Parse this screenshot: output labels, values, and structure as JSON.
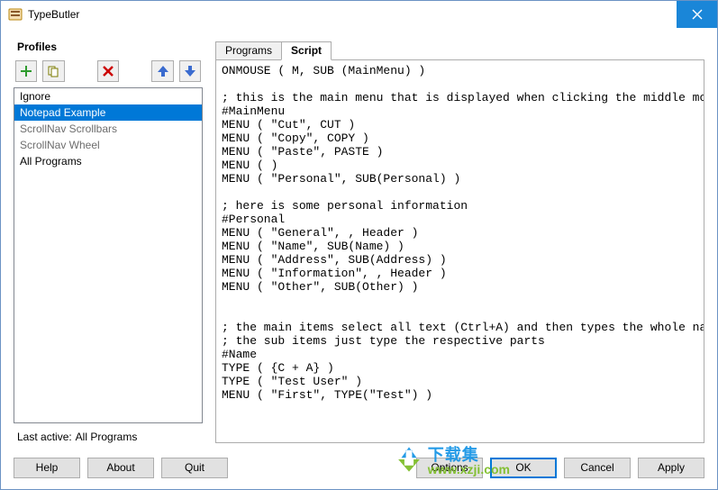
{
  "window": {
    "title": "TypeButler"
  },
  "profiles": {
    "heading": "Profiles",
    "items": [
      {
        "label": "Ignore",
        "selected": false,
        "dim": false
      },
      {
        "label": "Notepad Example",
        "selected": true,
        "dim": false
      },
      {
        "label": "ScrollNav Scrollbars",
        "selected": false,
        "dim": true
      },
      {
        "label": "ScrollNav Wheel",
        "selected": false,
        "dim": true
      },
      {
        "label": "All Programs",
        "selected": false,
        "dim": false
      }
    ],
    "last_active_label": "Last active:",
    "last_active_value": "All Programs"
  },
  "toolbar": {
    "add": "add",
    "copy": "copy",
    "delete": "delete",
    "move_up": "move up",
    "move_down": "move down"
  },
  "tabs": {
    "programs": "Programs",
    "script": "Script",
    "active": "script"
  },
  "script": "ONMOUSE ( M, SUB (MainMenu) )\n\n; this is the main menu that is displayed when clicking the middle mouse button\n#MainMenu\nMENU ( \"Cut\", CUT )\nMENU ( \"Copy\", COPY )\nMENU ( \"Paste\", PASTE )\nMENU ( )\nMENU ( \"Personal\", SUB(Personal) )\n\n; here is some personal information\n#Personal\nMENU ( \"General\", , Header )\nMENU ( \"Name\", SUB(Name) )\nMENU ( \"Address\", SUB(Address) )\nMENU ( \"Information\", , Header )\nMENU ( \"Other\", SUB(Other) )\n\n\n; the main items select all text (Ctrl+A) and then types the whole name / address\n; the sub items just type the respective parts\n#Name\nTYPE ( {C + A} )\nTYPE ( \"Test User\" )\nMENU ( \"First\", TYPE(\"Test\") )",
  "buttons": {
    "help": "Help",
    "about": "About",
    "quit": "Quit",
    "options": "Options",
    "ok": "OK",
    "cancel": "Cancel",
    "apply": "Apply"
  },
  "watermark": {
    "line1": "下载集",
    "line2": "www.xzji.com"
  }
}
